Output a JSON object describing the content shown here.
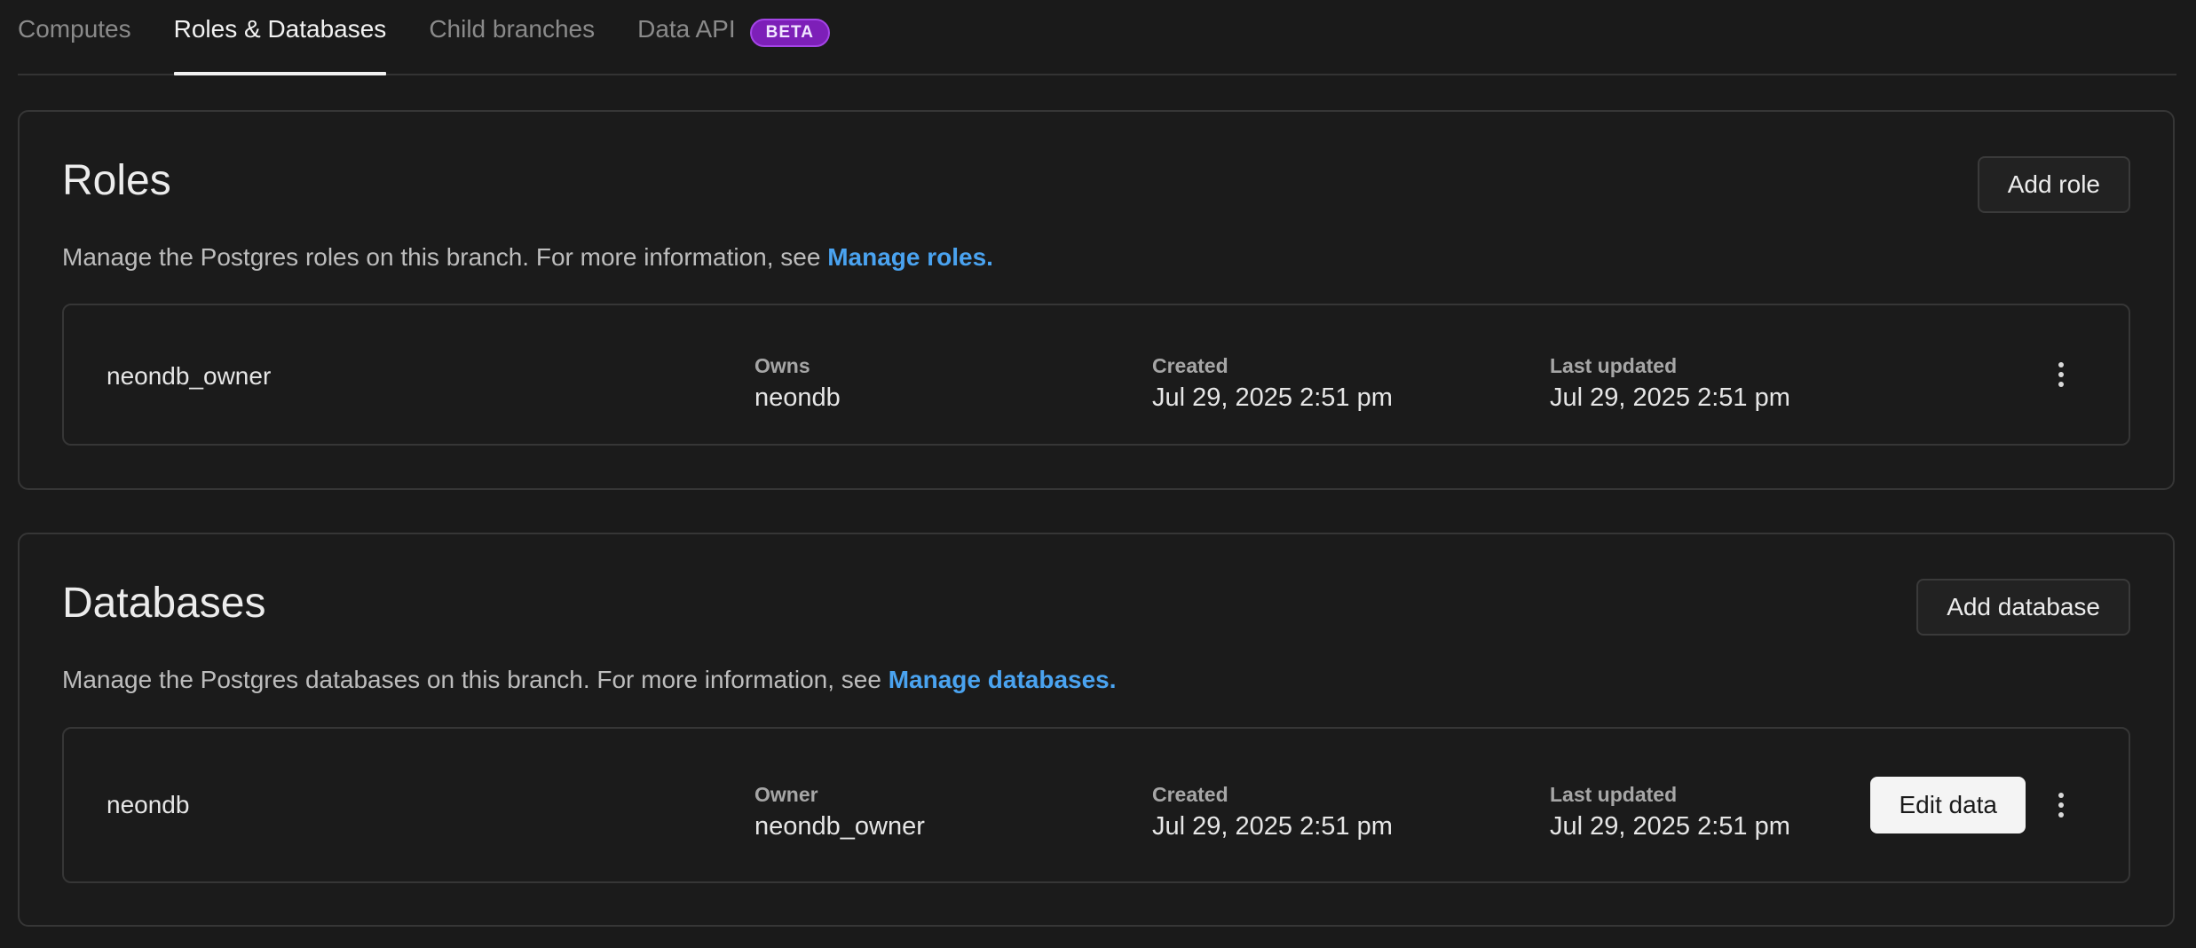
{
  "tabs": [
    {
      "label": "Computes",
      "active": false
    },
    {
      "label": "Roles & Databases",
      "active": true
    },
    {
      "label": "Child branches",
      "active": false
    },
    {
      "label": "Data API",
      "active": false,
      "badge": "BETA"
    }
  ],
  "roles": {
    "title": "Roles",
    "add_button": "Add role",
    "description": "Manage the Postgres roles on this branch. For more information, see ",
    "link": "Manage roles.",
    "items": [
      {
        "name": "neondb_owner",
        "col1_label": "Owns",
        "col1_value": "neondb",
        "created_label": "Created",
        "created_value": "Jul 29, 2025 2:51 pm",
        "updated_label": "Last updated",
        "updated_value": "Jul 29, 2025 2:51 pm"
      }
    ]
  },
  "databases": {
    "title": "Databases",
    "add_button": "Add database",
    "description": "Manage the Postgres databases on this branch. For more information, see ",
    "link": "Manage databases.",
    "items": [
      {
        "name": "neondb",
        "col1_label": "Owner",
        "col1_value": "neondb_owner",
        "created_label": "Created",
        "created_value": "Jul 29, 2025 2:51 pm",
        "updated_label": "Last updated",
        "updated_value": "Jul 29, 2025 2:51 pm",
        "edit_button": "Edit data"
      }
    ]
  },
  "colors": {
    "background": "#1a1a1a",
    "link": "#4aa3f0",
    "badge": "#7d1fb8"
  },
  "icons": {
    "row_menu": "kebab-menu-icon"
  }
}
